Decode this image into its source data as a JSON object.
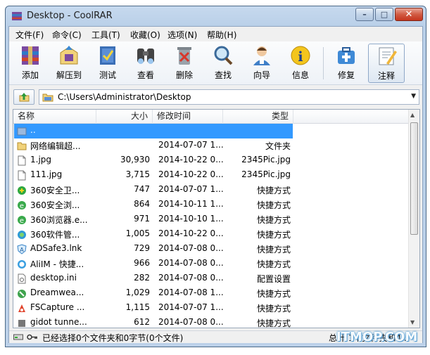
{
  "window": {
    "title": "Desktop - CoolRAR"
  },
  "menu": [
    "文件(F)",
    "命令(C)",
    "工具(T)",
    "收藏(O)",
    "选项(N)",
    "帮助(H)"
  ],
  "toolbar": [
    {
      "label": "添加",
      "icon": "add-archive-icon"
    },
    {
      "label": "解压到",
      "icon": "extract-icon"
    },
    {
      "label": "测试",
      "icon": "test-icon"
    },
    {
      "label": "查看",
      "icon": "view-binoculars-icon"
    },
    {
      "label": "删除",
      "icon": "delete-icon"
    },
    {
      "label": "查找",
      "icon": "find-magnifier-icon"
    },
    {
      "label": "向导",
      "icon": "wizard-user-icon"
    },
    {
      "label": "信息",
      "icon": "info-icon"
    },
    {
      "label": "修复",
      "icon": "repair-icon"
    },
    {
      "label": "注释",
      "icon": "comment-icon"
    }
  ],
  "address": {
    "path": "C:\\Users\\Administrator\\Desktop"
  },
  "columns": [
    "名称",
    "大小",
    "修改时间",
    "类型"
  ],
  "files": [
    {
      "name": "..",
      "size": "",
      "date": "",
      "type": "",
      "icon": "up-folder-icon",
      "selected": true
    },
    {
      "name": "网络编辑超...",
      "size": "",
      "date": "2014-07-07 1...",
      "type": "文件夹",
      "icon": "folder-icon"
    },
    {
      "name": "1.jpg",
      "size": "30,930",
      "date": "2014-10-22 0...",
      "type": "2345Pic.jpg",
      "icon": "file-icon"
    },
    {
      "name": "111.jpg",
      "size": "3,715",
      "date": "2014-10-22 0...",
      "type": "2345Pic.jpg",
      "icon": "file-icon"
    },
    {
      "name": "360安全卫...",
      "size": "747",
      "date": "2014-07-07 1...",
      "type": "快捷方式",
      "icon": "360-safe-icon"
    },
    {
      "name": "360安全浏...",
      "size": "864",
      "date": "2014-10-11 1...",
      "type": "快捷方式",
      "icon": "360-browser-icon"
    },
    {
      "name": "360浏览器.e...",
      "size": "971",
      "date": "2014-10-10 1...",
      "type": "快捷方式",
      "icon": "360-browser-icon"
    },
    {
      "name": "360软件管...",
      "size": "1,005",
      "date": "2014-10-22 0...",
      "type": "快捷方式",
      "icon": "360-software-icon"
    },
    {
      "name": "ADSafe3.lnk",
      "size": "729",
      "date": "2014-07-08 0...",
      "type": "快捷方式",
      "icon": "adsafe-icon"
    },
    {
      "name": "AliIM - 快捷...",
      "size": "966",
      "date": "2014-07-08 0...",
      "type": "快捷方式",
      "icon": "aliim-icon"
    },
    {
      "name": "desktop.ini",
      "size": "282",
      "date": "2014-07-08 0...",
      "type": "配置设置",
      "icon": "settings-file-icon"
    },
    {
      "name": "Dreamwea...",
      "size": "1,029",
      "date": "2014-07-08 1...",
      "type": "快捷方式",
      "icon": "dreamweaver-icon"
    },
    {
      "name": "FSCapture ...",
      "size": "1,115",
      "date": "2014-07-07 1...",
      "type": "快捷方式",
      "icon": "fscapture-icon"
    },
    {
      "name": "gidot tunne...",
      "size": "612",
      "date": "2014-07-08 0...",
      "type": "快捷方式",
      "icon": "shortcut-icon"
    }
  ],
  "status": {
    "left": "已经选择0个文件夹和0字节(0个文件)",
    "right": "总计 1个文件夹和4...",
    "watermark": "ITMOP.COM"
  },
  "colors": {
    "selection": "#3399ff",
    "title_bar": "#bcd1e9"
  }
}
